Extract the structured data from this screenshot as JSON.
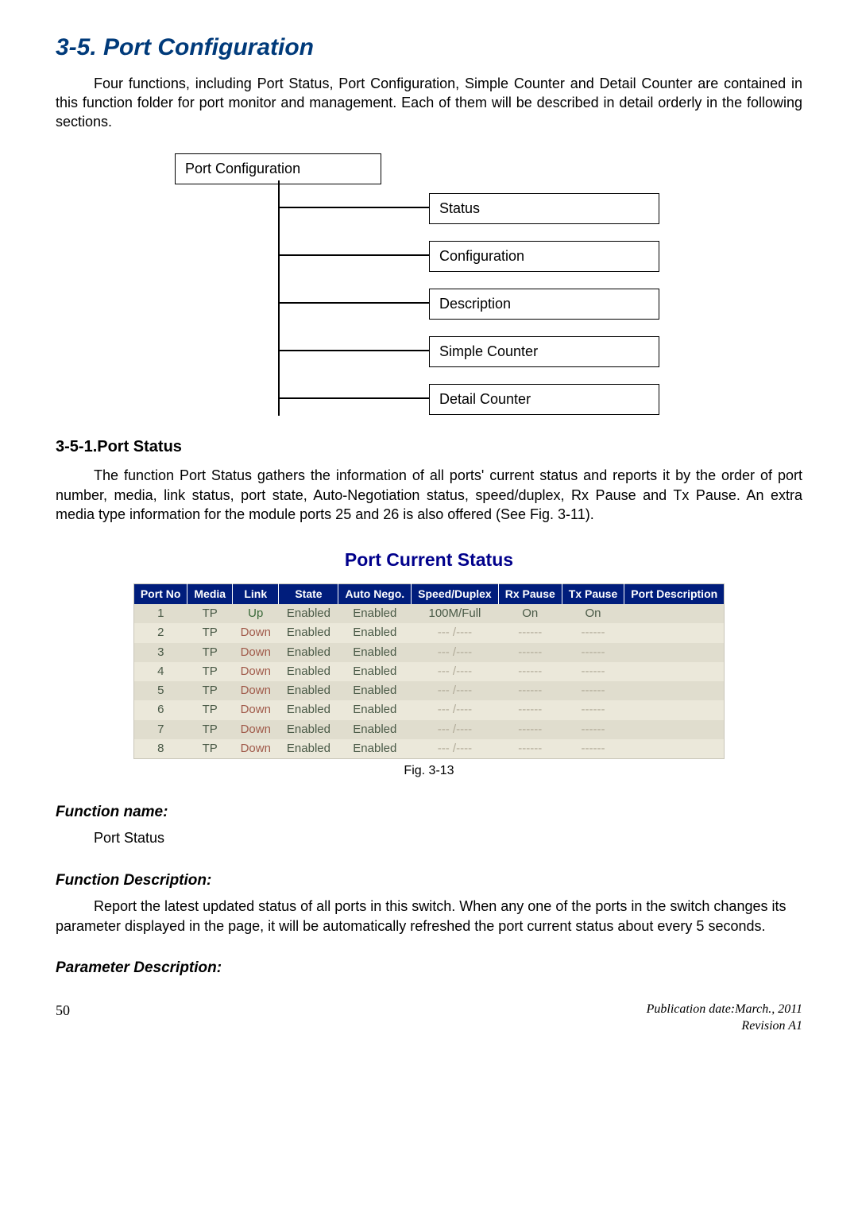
{
  "section": {
    "title": "3-5. Port Configuration",
    "intro": "Four functions, including Port Status, Port Configuration, Simple Counter and Detail Counter are contained in this function folder for port monitor and management. Each of them will be described in detail orderly in the following sections."
  },
  "diagram": {
    "root": "Port Configuration",
    "items": [
      "Status",
      "Configuration",
      "Description",
      "Simple Counter",
      "Detail Counter"
    ]
  },
  "subsection": {
    "heading": "3-5-1.Port Status",
    "body": "The function Port Status gathers the information of all ports' current status and reports it by the order of port number, media, link status, port state, Auto-Negotiation status, speed/duplex, Rx Pause and Tx Pause. An extra media type information for the module ports 25 and 26 is also offered (See Fig. 3-11)."
  },
  "chart_title": "Port Current Status",
  "chart_data": {
    "type": "table",
    "headers": [
      "Port No",
      "Media",
      "Link",
      "State",
      "Auto Nego.",
      "Speed/Duplex",
      "Rx Pause",
      "Tx Pause",
      "Port Description"
    ],
    "rows": [
      {
        "port": "1",
        "media": "TP",
        "link": "Up",
        "state": "Enabled",
        "nego": "Enabled",
        "sd": "100M/Full",
        "rx": "On",
        "tx": "On",
        "desc": ""
      },
      {
        "port": "2",
        "media": "TP",
        "link": "Down",
        "state": "Enabled",
        "nego": "Enabled",
        "sd": "--- /----",
        "rx": "------",
        "tx": "------",
        "desc": ""
      },
      {
        "port": "3",
        "media": "TP",
        "link": "Down",
        "state": "Enabled",
        "nego": "Enabled",
        "sd": "--- /----",
        "rx": "------",
        "tx": "------",
        "desc": ""
      },
      {
        "port": "4",
        "media": "TP",
        "link": "Down",
        "state": "Enabled",
        "nego": "Enabled",
        "sd": "--- /----",
        "rx": "------",
        "tx": "------",
        "desc": ""
      },
      {
        "port": "5",
        "media": "TP",
        "link": "Down",
        "state": "Enabled",
        "nego": "Enabled",
        "sd": "--- /----",
        "rx": "------",
        "tx": "------",
        "desc": ""
      },
      {
        "port": "6",
        "media": "TP",
        "link": "Down",
        "state": "Enabled",
        "nego": "Enabled",
        "sd": "--- /----",
        "rx": "------",
        "tx": "------",
        "desc": ""
      },
      {
        "port": "7",
        "media": "TP",
        "link": "Down",
        "state": "Enabled",
        "nego": "Enabled",
        "sd": "--- /----",
        "rx": "------",
        "tx": "------",
        "desc": ""
      },
      {
        "port": "8",
        "media": "TP",
        "link": "Down",
        "state": "Enabled",
        "nego": "Enabled",
        "sd": "--- /----",
        "rx": "------",
        "tx": "------",
        "desc": ""
      }
    ]
  },
  "caption": "Fig. 3-13",
  "function": {
    "name_label": "Function name:",
    "name_value": "Port Status",
    "desc_label": "Function Description:",
    "desc_value": "Report the latest updated status of all ports in this switch. When any one of the ports in the switch changes its parameter displayed in the page, it will be automatically refreshed the port current status about every 5 seconds.",
    "param_label": "Parameter Description:"
  },
  "footer": {
    "page": "50",
    "pub": "Publication date:March., 2011",
    "rev": "Revision A1"
  }
}
